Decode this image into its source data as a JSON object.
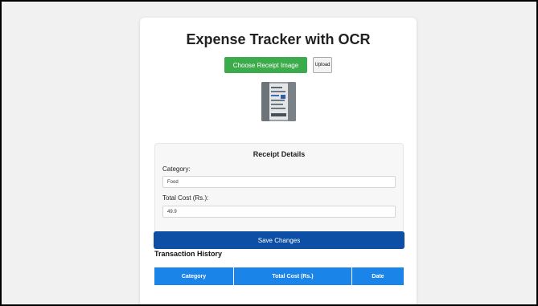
{
  "app": {
    "title": "Expense Tracker with OCR"
  },
  "upload": {
    "choose_label": "Choose Receipt Image",
    "upload_label": "Upload"
  },
  "receipt": {
    "title": "Receipt Details",
    "category_label": "Category:",
    "category_value": "Food",
    "total_label": "Total Cost (Rs.):",
    "total_value": "49.9"
  },
  "actions": {
    "save_label": "Save Changes"
  },
  "history": {
    "title": "Transaction History",
    "columns": [
      "Category",
      "Total Cost (Rs.)",
      "Date"
    ]
  },
  "colors": {
    "choose_button": "#3cab4b",
    "save_button": "#0d4fa4",
    "table_header": "#1b84e8"
  },
  "icons": {
    "receipt_thumbnail": "receipt-image"
  }
}
